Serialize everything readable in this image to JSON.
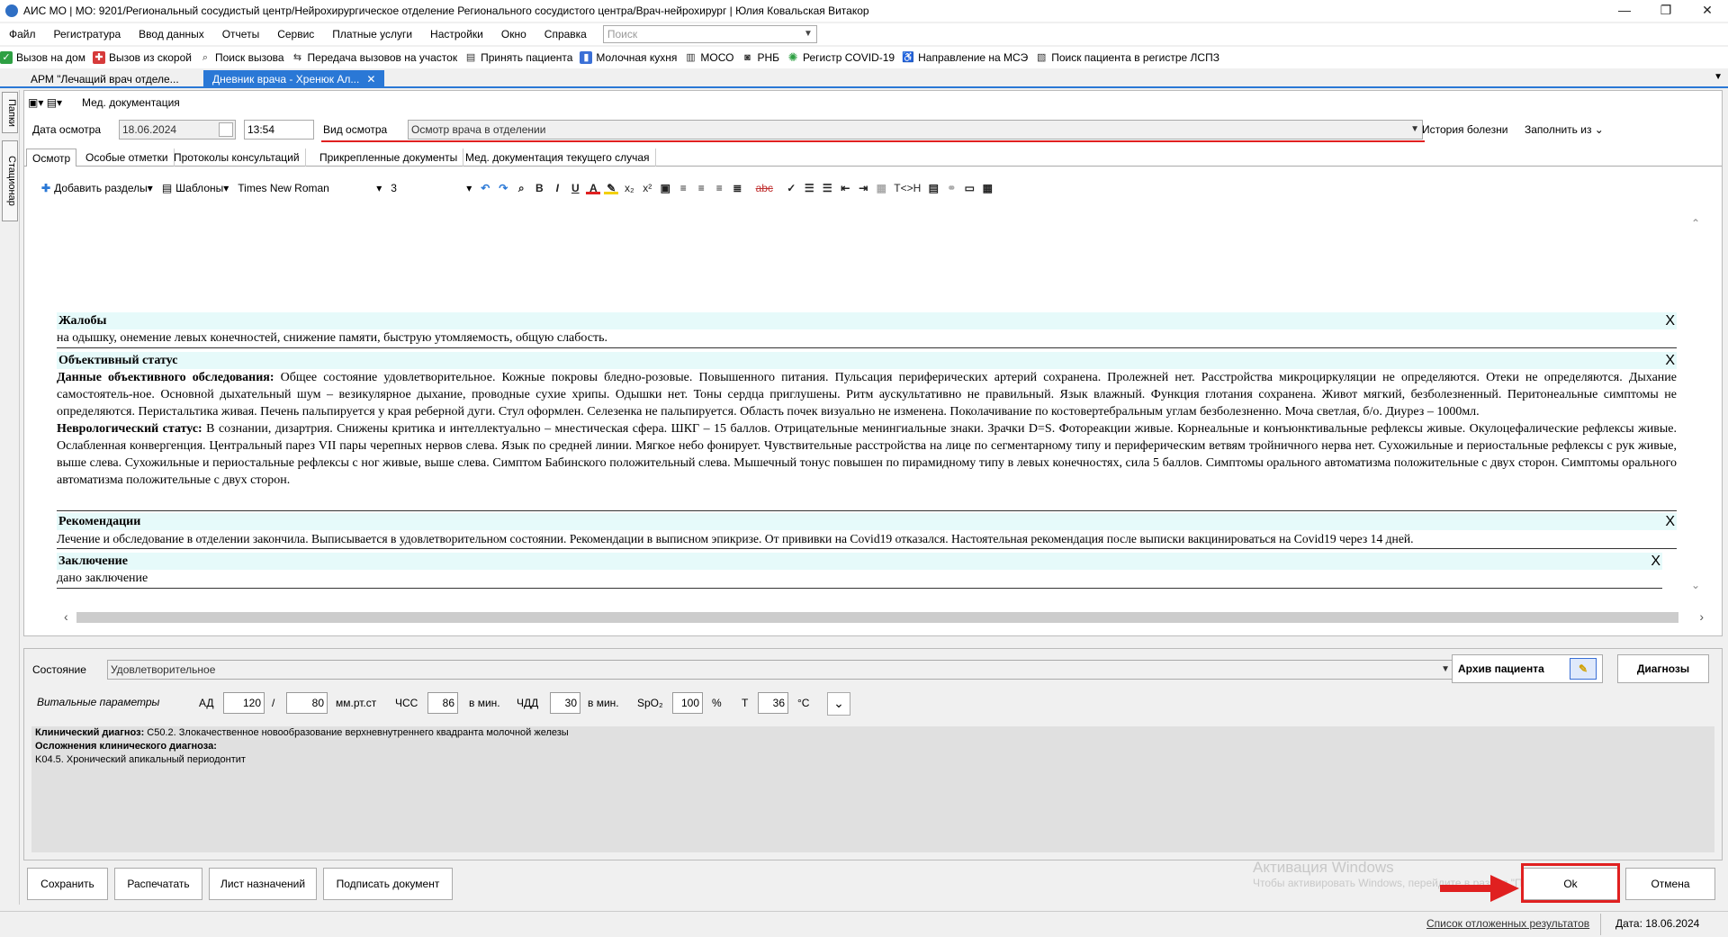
{
  "window": {
    "title": "АИС МО | МО: 9201/Региональный сосудистый центр/Нейрохирургическое отделение Регионального сосудистого центра/Врач-нейрохирург | Юлия Ковальская Витакор",
    "btn_min": "—",
    "btn_max": "❐",
    "btn_close": "✕"
  },
  "menu": {
    "items": [
      "Файл",
      "Регистратура",
      "Ввод данных",
      "Отчеты",
      "Сервис",
      "Платные услуги",
      "Настройки",
      "Окно",
      "Справка"
    ],
    "search_placeholder": "Поиск"
  },
  "toolbar": {
    "items": [
      {
        "label": "Вызов на дом",
        "color": "#2ea043"
      },
      {
        "label": "Вызов из скорой",
        "color": "#d63a3a"
      },
      {
        "label": "Поиск вызова",
        "color": "#555555"
      },
      {
        "label": "Передача вызовов на участок",
        "color": "#555555"
      },
      {
        "label": "Принять пациента",
        "color": "#555555"
      },
      {
        "label": "Молочная кухня",
        "color": "#3a6fd6"
      },
      {
        "label": "МОСО",
        "color": "#555555"
      },
      {
        "label": "РНБ",
        "color": "#555555"
      },
      {
        "label": "Регистр COVID-19",
        "color": "#2ea043"
      },
      {
        "label": "Направление на МСЭ",
        "color": "#555555"
      },
      {
        "label": "Поиск пациента в регистре ЛСПЗ",
        "color": "#555555"
      }
    ]
  },
  "doc_tabs": [
    {
      "label": "АРМ \"Лечащий врач отделе...",
      "close": ""
    },
    {
      "label": "Дневник врача - Хренюк Ал...",
      "close": "✕"
    }
  ],
  "side_rail": {
    "tab1": "Папки",
    "tab2": "Стационар"
  },
  "panel": {
    "header_label": "Мед. документация",
    "date_label": "Дата осмотра",
    "date_value": "18.06.2024",
    "time_value": "13:54",
    "exam_type_label": "Вид осмотра",
    "exam_type_value": "Осмотр врача в отделении",
    "history_button": "История болезни",
    "fill_from_button": "Заполнить из"
  },
  "subtabs": [
    "Осмотр",
    "Особые отметки",
    "Протоколы консультаций",
    "Прикрепленные документы",
    "Мед. документация текущего случая"
  ],
  "editor_toolbar": {
    "add_sections": "Добавить разделы",
    "templates": "Шаблоны",
    "font": "Times New Roman",
    "size": "3",
    "bold": "B",
    "italic": "I",
    "underline": "U",
    "color": "A",
    "subscript": "x₂",
    "superscript": "x²",
    "abc": "abc",
    "tch": "T<>H"
  },
  "sections": [
    {
      "title": "Жалобы",
      "close": "X",
      "body": "на одышку, онемение левых конечностей, снижение памяти, быструю утомляемость, общую слабость."
    },
    {
      "title": "Объективный статус",
      "close": "X",
      "lead1": "Данные объективного обследования:",
      "body1": " Общее состояние удовлетворительное. Кожные покровы бледно-розовые. Повышенного питания. Пульсация периферических артерий сохранена. Пролежней нет. Расстройства микроциркуляции не определяются. Отеки не определяются. Дыхание самостоятель-ное. Основной дыхательный шум – везикулярное дыхание, проводные сухие хрипы. Одышки нет. Тоны сердца приглушены. Ритм аускультативно не правильный. Язык влажный. Функция глотания сохранена. Живот мягкий, безболезненный. Перитонеальные симптомы не определяются. Перистальтика живая. Печень пальпируется у края реберной дуги. Стул оформлен. Селезенка не пальпируется. Область почек визуально не изменена. Поколачивание по костовертебральным углам безболезненно. Моча светлая, б/о. Диурез – 1000мл.",
      "lead2": "Неврологический статус:",
      "body2": " В сознании, дизартрия. Снижены критика и интеллектуально – мнестическая сфера. ШКГ – 15 баллов. Отрицательные менингиальные знаки. Зрачки D=S. Фотореакции живые. Корнеальные и конъюнктивальные рефлексы живые. Окулоцефалические рефлексы живые. Ослабленная конвергенция. Центральный парез VII пары черепных нервов слева. Язык по средней линии. Мягкое небо фонирует. Чувствительные расстройства на лице по сегментарному типу и периферическим ветвям тройничного нерва нет. Сухожильные и периостальные рефлексы с рук живые, выше слева. Сухожильные и периостальные рефлексы с ног живые, выше слева. Симптом Бабинского положительный слева. Мышечный тонус повышен по пирамидному типу в левых конечностях, сила 5 баллов. Симптомы орального автоматизма положительные с двух сторон. Симптомы орального автоматизма положительные с двух сторон."
    },
    {
      "title": "Рекомендации",
      "close": "X",
      "body": "Лечение и обследование в отделении закончила. Выписывается в удовлетворительном  состоянии. Рекомендации в выписном эпикризе. От прививки  на Covid19 отказался. Настоятельная рекомендация после выписки вакцинироваться на Covid19 через 14 дней."
    },
    {
      "title": "Заключение",
      "close": "X",
      "body": "дано заключение"
    }
  ],
  "lower": {
    "state_label": "Состояние",
    "state_value": "Удовлетворительное",
    "archive_button": "Архив пациента",
    "diagnoses_button": "Диагнозы",
    "vitals_label": "Витальные параметры",
    "ad_label": "АД",
    "ad_sys": "120",
    "slash": "/",
    "ad_dia": "80",
    "ad_unit": "мм.рт.ст",
    "hr_label": "ЧСС",
    "hr": "86",
    "hr_unit": "в мин.",
    "rr_label": "ЧДД",
    "rr": "30",
    "rr_unit": "в мин.",
    "spo2_label": "SpO₂",
    "spo2": "100",
    "spo2_unit": "%",
    "t_label": "Т",
    "t": "36",
    "t_unit": "°C",
    "diag_label": "Клинический диагноз:",
    "diag_value": " C50.2. Злокачественное новообразование верхневнутреннего квадранта молочной железы",
    "compl_label": "Осложнения клинического диагноза:",
    "compl_value": "K04.5. Хронический апикальный периодонтит"
  },
  "bottom": {
    "save": "Сохранить",
    "print": "Распечатать",
    "prescriptions": "Лист назначений",
    "sign": "Подписать документ",
    "ok": "Ok",
    "cancel": "Отмена",
    "ghost_activation": "Активация Windows",
    "ghost_hint": "Чтобы активировать Windows, перейдите в раздел \"Параметры\"."
  },
  "status": {
    "deferred": "Список отложенных результатов",
    "date": "Дата: 18.06.2024"
  },
  "colors": {
    "accent": "#2a78d6",
    "highlight": "#e02020",
    "section_bg": "#e6fafa"
  }
}
